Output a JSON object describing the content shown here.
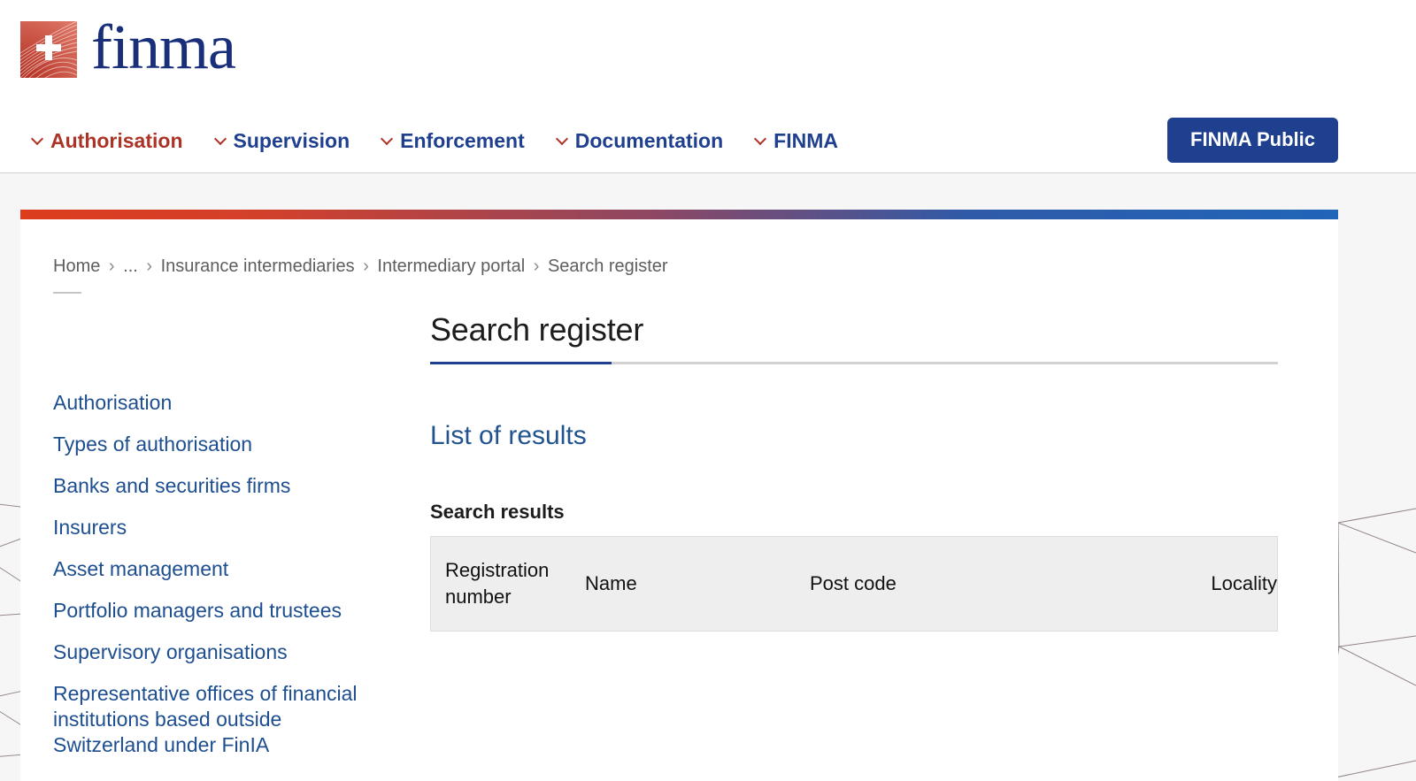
{
  "brand": {
    "logo_wordmark": "finma",
    "logo_icon": "swiss-cross-flag-icon",
    "colors": {
      "primary_blue": "#1f3f8f",
      "link_blue": "#1d4e8f",
      "accent_red": "#ad3326",
      "gradient_start": "#dd3c1d",
      "gradient_end": "#2065b8",
      "table_header_bg": "#eeeeee"
    }
  },
  "nav": {
    "items": [
      {
        "label": "Authorisation",
        "active": true
      },
      {
        "label": "Supervision",
        "active": false
      },
      {
        "label": "Enforcement",
        "active": false
      },
      {
        "label": "Documentation",
        "active": false
      },
      {
        "label": "FINMA",
        "active": false
      }
    ],
    "cta_label": "FINMA Public"
  },
  "breadcrumb": {
    "items": [
      "Home",
      "...",
      "Insurance intermediaries",
      "Intermediary portal",
      "Search register"
    ],
    "separator": "›"
  },
  "sidebar": {
    "items": [
      {
        "label": "Authorisation"
      },
      {
        "label": "Types of authorisation"
      },
      {
        "label": "Banks and securities firms"
      },
      {
        "label": "Insurers"
      },
      {
        "label": "Asset management"
      },
      {
        "label": "Portfolio managers and trustees"
      },
      {
        "label": "Supervisory organisations"
      },
      {
        "label": "Representative offices of financial institutions based outside Switzerland under FinIA"
      }
    ]
  },
  "main": {
    "page_title": "Search register",
    "section_title": "List of results",
    "results_label": "Search results",
    "table": {
      "columns": [
        "Registration number",
        "Name",
        "Post code",
        "Locality"
      ],
      "rows": []
    }
  }
}
